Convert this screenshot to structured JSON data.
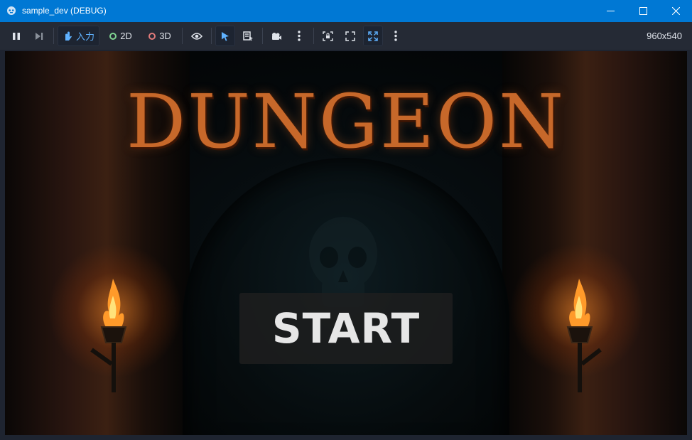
{
  "window": {
    "title": "sample_dev (DEBUG)",
    "controls": [
      "minimize",
      "maximize",
      "close"
    ]
  },
  "toolbar": {
    "input_label": "入力",
    "label_2d": "2D",
    "label_3d": "3D",
    "resolution": "960x540",
    "colors": {
      "ring_2d": "#7fd491",
      "ring_3d": "#e07a7a",
      "active_icon": "#5fb2ff"
    }
  },
  "game": {
    "title": "DUNGEON",
    "start_label": "START"
  }
}
